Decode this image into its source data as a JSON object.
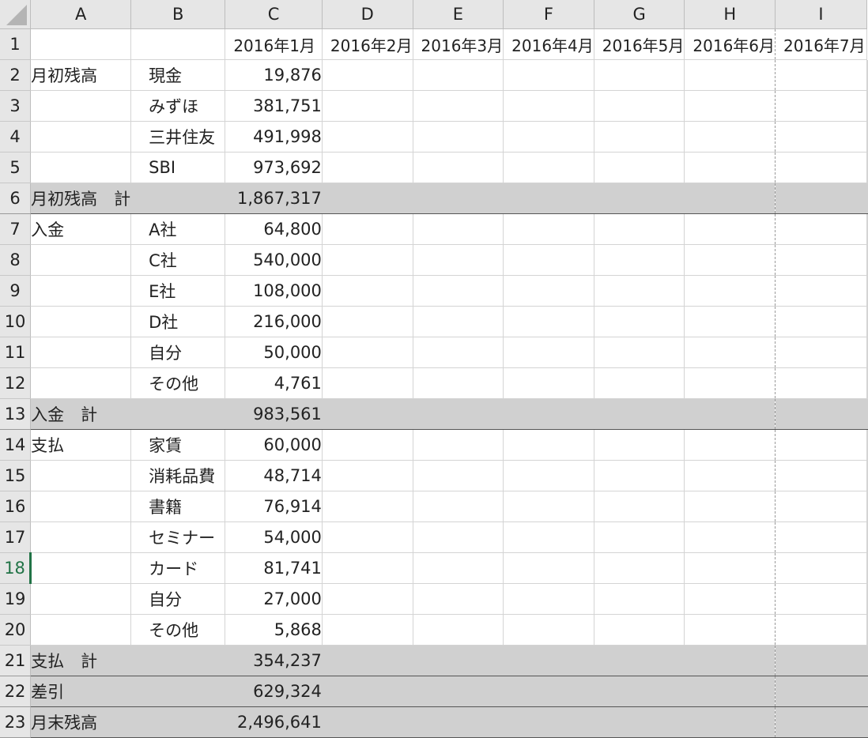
{
  "columns": [
    "A",
    "B",
    "C",
    "D",
    "E",
    "F",
    "G",
    "H",
    "I"
  ],
  "active_row": "18",
  "rows": [
    {
      "n": "1",
      "type": "header",
      "a": "",
      "b": "",
      "months": [
        "2016年1月",
        "2016年2月",
        "2016年3月",
        "2016年4月",
        "2016年5月",
        "2016年6月",
        "2016年7月"
      ]
    },
    {
      "n": "2",
      "type": "item",
      "a": "月初残高",
      "b": "現金",
      "c": "19,876"
    },
    {
      "n": "3",
      "type": "item",
      "a": "",
      "b": "みずほ",
      "c": "381,751"
    },
    {
      "n": "4",
      "type": "item",
      "a": "",
      "b": "三井住友",
      "c": "491,998"
    },
    {
      "n": "5",
      "type": "item",
      "a": "",
      "b": "SBI",
      "c": "973,692"
    },
    {
      "n": "6",
      "type": "total",
      "a": "月初残高　計",
      "c": "1,867,317"
    },
    {
      "n": "7",
      "type": "item",
      "a": "入金",
      "b": "A社",
      "c": "64,800"
    },
    {
      "n": "8",
      "type": "item",
      "a": "",
      "b": "C社",
      "c": "540,000"
    },
    {
      "n": "9",
      "type": "item",
      "a": "",
      "b": "E社",
      "c": "108,000"
    },
    {
      "n": "10",
      "type": "item",
      "a": "",
      "b": "D社",
      "c": "216,000"
    },
    {
      "n": "11",
      "type": "item",
      "a": "",
      "b": "自分",
      "c": "50,000"
    },
    {
      "n": "12",
      "type": "item",
      "a": "",
      "b": "その他",
      "c": "4,761"
    },
    {
      "n": "13",
      "type": "total",
      "a": "入金　計",
      "c": "983,561"
    },
    {
      "n": "14",
      "type": "item",
      "a": "支払",
      "b": "家賃",
      "c": "60,000"
    },
    {
      "n": "15",
      "type": "item",
      "a": "",
      "b": "消耗品費",
      "c": "48,714"
    },
    {
      "n": "16",
      "type": "item",
      "a": "",
      "b": "書籍",
      "c": "76,914"
    },
    {
      "n": "17",
      "type": "item",
      "a": "",
      "b": "セミナー",
      "c": "54,000"
    },
    {
      "n": "18",
      "type": "item",
      "a": "",
      "b": "カード",
      "c": "81,741"
    },
    {
      "n": "19",
      "type": "item",
      "a": "",
      "b": "自分",
      "c": "27,000"
    },
    {
      "n": "20",
      "type": "item",
      "a": "",
      "b": "その他",
      "c": "5,868"
    },
    {
      "n": "21",
      "type": "total",
      "a": "支払　計",
      "c": "354,237"
    },
    {
      "n": "22",
      "type": "total",
      "a": "差引",
      "c": "629,324"
    },
    {
      "n": "23",
      "type": "total",
      "a": "月末残高",
      "c": "2,496,641"
    }
  ]
}
